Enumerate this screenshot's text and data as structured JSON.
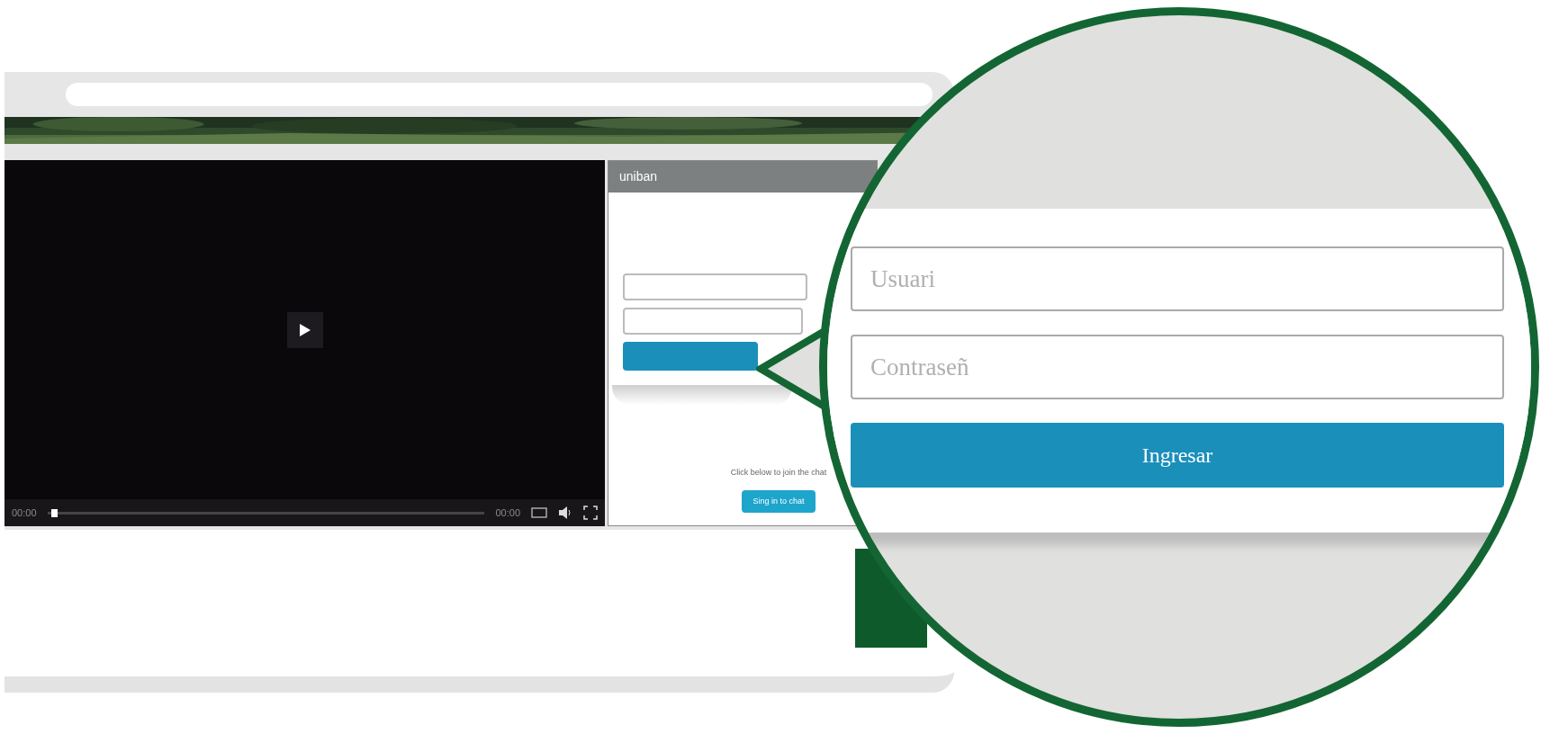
{
  "player": {
    "current_time": "00:00",
    "duration": "00:00",
    "level": 0.01
  },
  "chat": {
    "brand": "uniban",
    "prompt": "Click below to join the chat",
    "button": "Sing in to chat"
  },
  "magnifier": {
    "fields": [
      {
        "placeholder": "Usuari"
      },
      {
        "placeholder": "Contraseñ"
      }
    ],
    "button": "Ingresar"
  }
}
